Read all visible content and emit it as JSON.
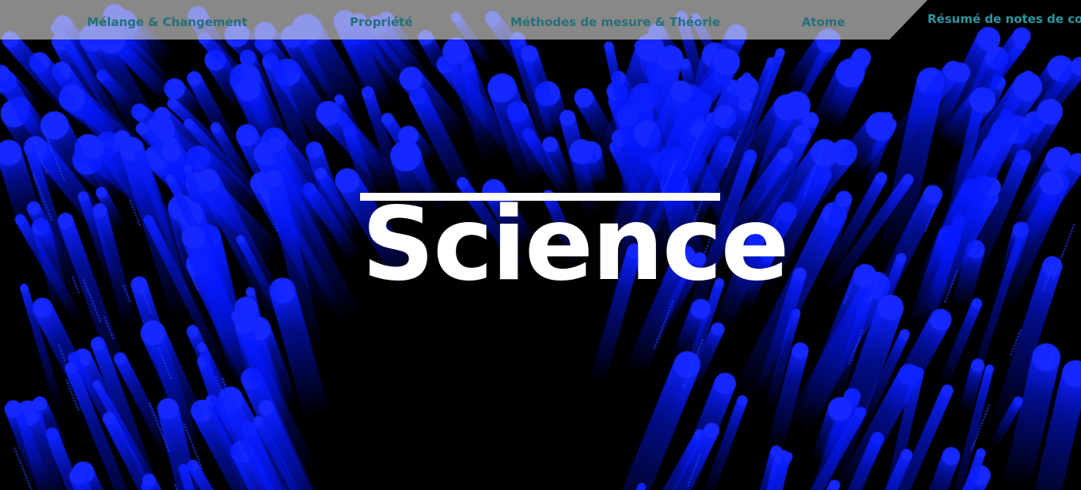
{
  "nav": {
    "items": [
      {
        "label": "Mélange & Changement"
      },
      {
        "label": "Propriété"
      },
      {
        "label": "Méthodes de mesure & Théorie"
      },
      {
        "label": "Atome"
      },
      {
        "label": "Résumé de notes de cours"
      }
    ],
    "text_color": "#23707a",
    "active_text_color": "#2a97a0",
    "band_color": "#dcdcdc"
  },
  "hero": {
    "title": "Science",
    "title_color": "#ffffff",
    "background_color": "#000000",
    "streak_color": "#0a1cff",
    "background_image": "blue-light-streaks"
  }
}
